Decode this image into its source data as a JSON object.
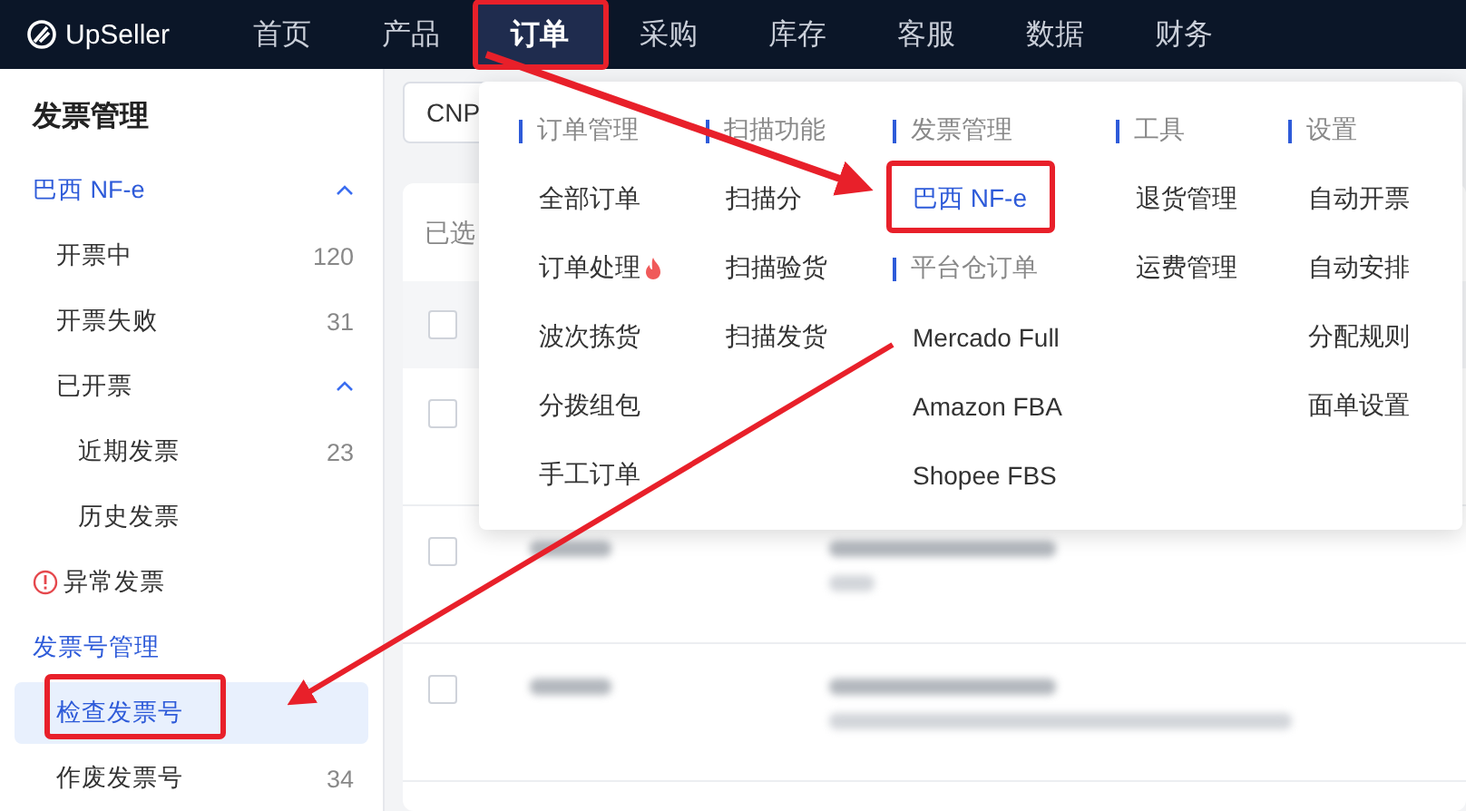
{
  "logo": {
    "text": "UpSeller"
  },
  "nav": [
    {
      "label": "首页",
      "selected": false
    },
    {
      "label": "产品",
      "selected": false
    },
    {
      "label": "订单",
      "selected": true
    },
    {
      "label": "采购",
      "selected": false
    },
    {
      "label": "库存",
      "selected": false
    },
    {
      "label": "客服",
      "selected": false
    },
    {
      "label": "数据",
      "selected": false
    },
    {
      "label": "财务",
      "selected": false
    }
  ],
  "sidebar": {
    "title": "发票管理",
    "items": [
      {
        "label": "巴西 NF-e",
        "kind": "group",
        "expanded": true,
        "selected": false,
        "children": [
          {
            "label": "开票中",
            "count": "120",
            "selected": false
          },
          {
            "label": "开票失败",
            "count": "31",
            "selected": false
          },
          {
            "label": "已开票",
            "expanded": true,
            "selected": false,
            "children": [
              {
                "label": "近期发票",
                "count": "23",
                "selected": false
              },
              {
                "label": "历史发票",
                "selected": false
              }
            ]
          }
        ]
      },
      {
        "label": "异常发票",
        "kind": "alert",
        "selected": false
      },
      {
        "label": "发票号管理",
        "kind": "group",
        "selected": false,
        "children": [
          {
            "label": "检查发票号",
            "selected": true
          },
          {
            "label": "作废发票号",
            "count": "34",
            "selected": false
          }
        ]
      }
    ]
  },
  "filter": {
    "value": "CNP"
  },
  "table": {
    "toolbar_text": "已选",
    "header_checked": false,
    "rows": [
      {
        "checked": false
      },
      {
        "checked": false
      },
      {
        "checked": false
      }
    ]
  },
  "menu": {
    "columns": [
      [
        {
          "heading": "订单管理",
          "items": [
            {
              "label": "全部订单",
              "selected": false,
              "hot": false
            },
            {
              "label": "订单处理",
              "selected": false,
              "hot": true
            },
            {
              "label": "波次拣货",
              "selected": false,
              "hot": false
            },
            {
              "label": "分拨组包",
              "selected": false,
              "hot": false
            },
            {
              "label": "手工订单",
              "selected": false,
              "hot": false
            }
          ]
        }
      ],
      [
        {
          "heading": "扫描功能",
          "items": [
            {
              "label": "扫描分",
              "selected": false,
              "hot": false
            },
            {
              "label": "扫描验货",
              "selected": false,
              "hot": false
            },
            {
              "label": "扫描发货",
              "selected": false,
              "hot": false
            }
          ]
        }
      ],
      [
        {
          "heading": "发票管理",
          "items": [
            {
              "label": "巴西 NF-e",
              "selected": true,
              "hot": false
            }
          ]
        },
        {
          "heading": "平台仓订单",
          "items": [
            {
              "label": "Mercado Full",
              "selected": false,
              "hot": false
            },
            {
              "label": "Amazon FBA",
              "selected": false,
              "hot": false
            },
            {
              "label": "Shopee FBS",
              "selected": false,
              "hot": false
            }
          ]
        }
      ],
      [
        {
          "heading": "工具",
          "items": [
            {
              "label": "退货管理",
              "selected": false,
              "hot": false
            },
            {
              "label": "运费管理",
              "selected": false,
              "hot": false
            }
          ]
        }
      ],
      [
        {
          "heading": "设置",
          "items": [
            {
              "label": "自动开票",
              "selected": false,
              "hot": false
            },
            {
              "label": "自动安排",
              "selected": false,
              "hot": false
            },
            {
              "label": "分配规则",
              "selected": false,
              "hot": false
            },
            {
              "label": "面单设置",
              "selected": false,
              "hot": false
            }
          ]
        }
      ]
    ]
  }
}
